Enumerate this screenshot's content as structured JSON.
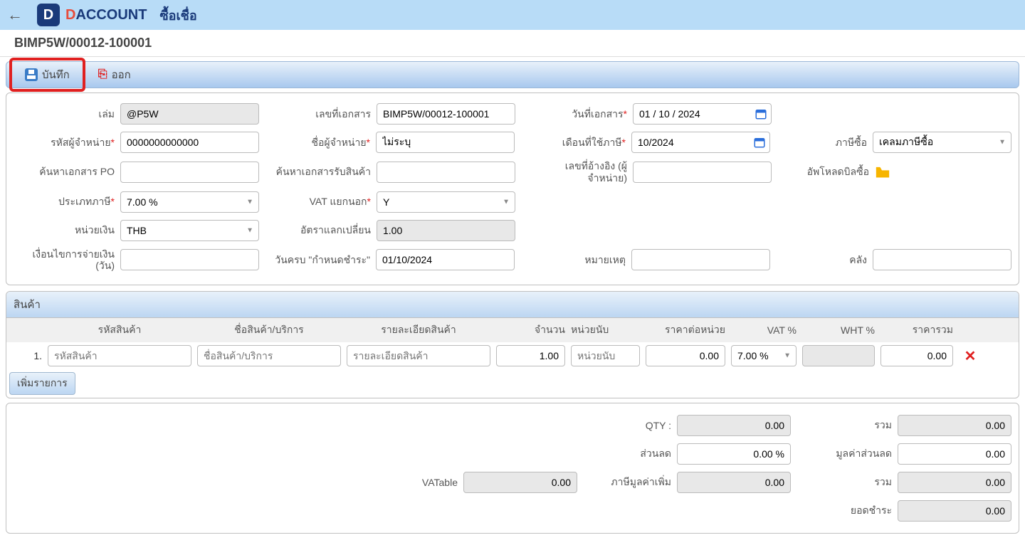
{
  "header": {
    "brand_prefix": "D",
    "brand_suffix": "ACCOUNT",
    "page_title": "ซื้อเชื่อ"
  },
  "doc_no_display": "BIMP5W/00012-100001",
  "toolbar": {
    "save_label": "บันทึก",
    "exit_label": "ออก"
  },
  "form": {
    "book_label": "เล่ม",
    "book_value": "@P5W",
    "doc_no_label": "เลขที่เอกสาร",
    "doc_no_value": "BIMP5W/00012-100001",
    "doc_date_label": "วันที่เอกสาร",
    "doc_date_value": "01 / 10 / 2024",
    "vendor_code_label": "รหัสผู้จำหน่าย",
    "vendor_code_value": "0000000000000",
    "vendor_name_label": "ชื่อผู้จำหน่าย",
    "vendor_name_value": "ไม่ระบุ",
    "tax_month_label": "เดือนที่ใช้ภาษี",
    "tax_month_value": "10/2024",
    "purchase_tax_label": "ภาษีซื้อ",
    "purchase_tax_value": "เคลมภาษีซื้อ",
    "po_search_label": "ค้นหาเอกสาร PO",
    "gr_search_label": "ค้นหาเอกสารรับสินค้า",
    "ref_no_label": "เลขที่อ้างอิง (ผู้จำหน่าย)",
    "upload_label": "อัพโหลดบิลซื้อ",
    "tax_type_label": "ประเภทภาษี",
    "tax_type_value": "7.00 %",
    "vat_excl_label": "VAT แยกนอก",
    "vat_excl_value": "Y",
    "currency_label": "หน่วยเงิน",
    "currency_value": "THB",
    "exrate_label": "อัตราแลกเปลี่ยน",
    "exrate_value": "1.00",
    "payment_terms_label": "เงื่อนไขการจ่ายเงิน (วัน)",
    "due_date_label": "วันครบ \"กำหนดชำระ\"",
    "due_date_value": "01/10/2024",
    "remark_label": "หมายเหตุ",
    "warehouse_label": "คลัง"
  },
  "items": {
    "section_title": "สินค้า",
    "headers": {
      "code": "รหัสสินค้า",
      "name": "ชื่อสินค้า/บริการ",
      "desc": "รายละเอียดสินค้า",
      "qty": "จำนวน",
      "unit": "หน่วยนับ",
      "price": "ราคาต่อหน่วย",
      "vat": "VAT %",
      "wht": "WHT %",
      "total": "ราคารวม"
    },
    "rows": [
      {
        "num": "1.",
        "code_ph": "รหัสสินค้า",
        "name_ph": "ชื่อสินค้า/บริการ",
        "desc_ph": "รายละเอียดสินค้า",
        "qty": "1.00",
        "unit_ph": "หน่วยนับ",
        "price": "0.00",
        "vat": "7.00 %",
        "wht": "",
        "total": "0.00"
      }
    ],
    "add_button": "เพิ่มรายการ"
  },
  "summary": {
    "qty_label": "QTY :",
    "qty_value": "0.00",
    "sum_label": "รวม",
    "sum_value": "0.00",
    "discount_label": "ส่วนลด",
    "discount_value": "0.00 %",
    "discount_amt_label": "มูลค่าส่วนลด",
    "discount_amt_value": "0.00",
    "vatable_label": "VATable",
    "vatable_value": "0.00",
    "vat_amt_label": "ภาษีมูลค่าเพิ่ม",
    "vat_amt_value": "0.00",
    "sum2_label": "รวม",
    "sum2_value": "0.00",
    "payable_label": "ยอดชำระ",
    "payable_value": "0.00"
  }
}
